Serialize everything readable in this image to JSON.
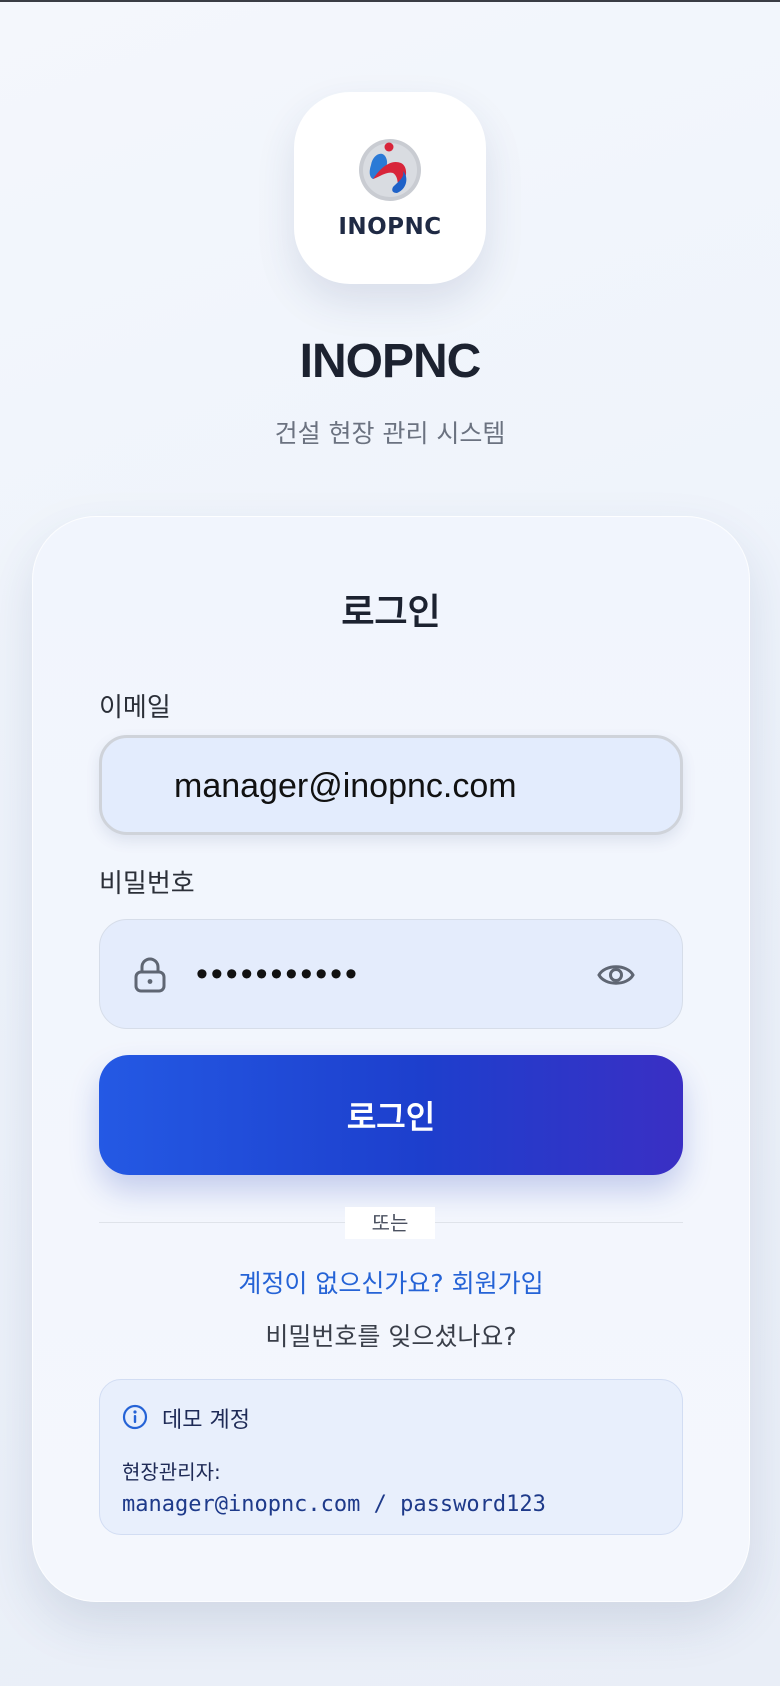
{
  "brand": {
    "logo_text": "INOPNC",
    "title": "INOPNC",
    "subtitle": "건설 현장 관리 시스템"
  },
  "login": {
    "heading": "로그인",
    "email_label": "이메일",
    "email_value": "manager@inopnc.com",
    "password_label": "비밀번호",
    "password_value": "password123",
    "submit_label": "로그인",
    "divider_text": "또는",
    "signup_text": "계정이 없으신가요? 회원가입",
    "forgot_text": "비밀번호를 잊으셨나요?"
  },
  "demo": {
    "title": "데모 계정",
    "role": "현장관리자:",
    "credentials": "manager@inopnc.com / password123"
  },
  "icons": {
    "lock": "lock-icon",
    "eye": "eye-icon",
    "info": "info-icon"
  },
  "colors": {
    "accent": "#2459e4",
    "link": "#2563d6",
    "logo_red": "#d8253a",
    "logo_blue": "#1f62c8"
  }
}
